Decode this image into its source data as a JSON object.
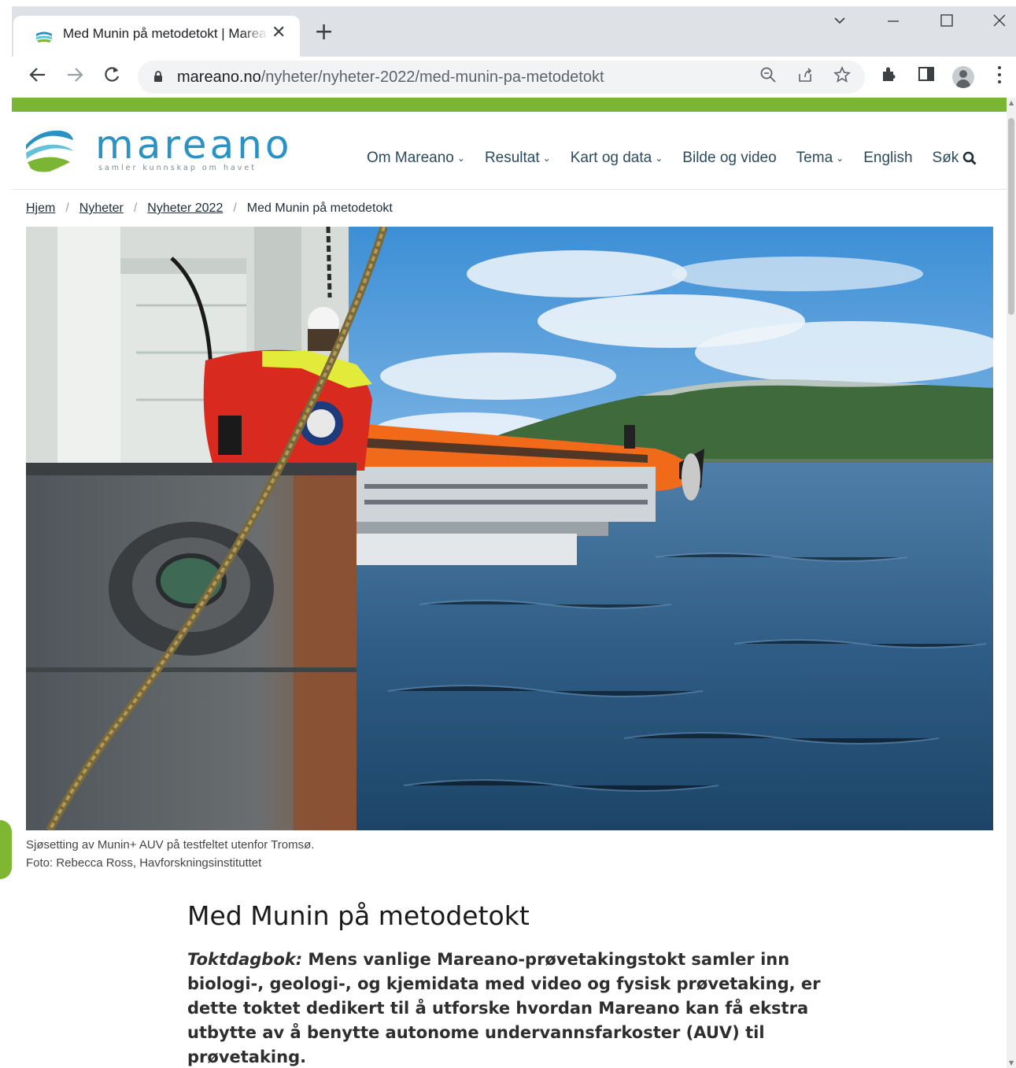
{
  "browser": {
    "tab_title": "Med Munin på metodetokt | Mareano",
    "tab_close": "✕",
    "new_tab": "+",
    "url_host": "mareano.no",
    "url_path": "/nyheter/nyheter-2022/med-munin-pa-metodetokt"
  },
  "site": {
    "logo_word": "mareano",
    "logo_tagline": "samler kunnskap om havet",
    "nav": [
      {
        "label": "Om Mareano"
      },
      {
        "label": "Resultat"
      },
      {
        "label": "Kart og data"
      },
      {
        "label": "Bilde og video"
      },
      {
        "label": "Tema"
      },
      {
        "label": "English"
      },
      {
        "label": "Søk"
      }
    ]
  },
  "breadcrumb": [
    "Hjem",
    "Nyheter",
    "Nyheter 2022",
    "Med Munin på metodetokt"
  ],
  "hero": {
    "caption_line1": "Sjøsetting av Munin+ AUV på testfeltet utenfor Tromsø.",
    "caption_line2": "Foto: Rebecca Ross, Havforskningsinstituttet"
  },
  "article": {
    "title": "Med Munin på metodetokt",
    "lead_label": "Toktdagbok:",
    "lead_text": " Mens vanlige Mareano-prøvetakingstokt samler inn biologi-, geologi-, og kjemidata med video og fysisk prøvetaking, er dette toktet dedikert til å utforske hvordan Mareano kan få ekstra utbytte av å benytte autonome undervannsfarkoster (AUV) til prøvetaking."
  },
  "colors": {
    "accent_green": "#7ab533",
    "logo_blue": "#2b92c4",
    "nav_text": "#2d4a5c"
  }
}
